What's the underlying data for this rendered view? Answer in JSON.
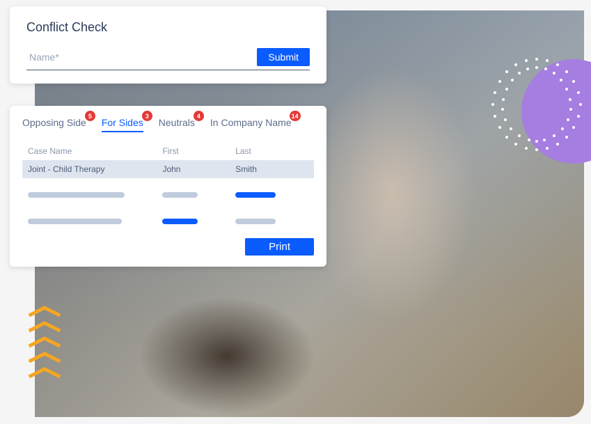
{
  "conflict_check": {
    "title": "Conflict Check",
    "name_placeholder": "Name*",
    "submit_label": "Submit"
  },
  "results": {
    "tabs": [
      {
        "label": "Opposing Side",
        "badge": "5",
        "active": false
      },
      {
        "label": "For Sides",
        "badge": "3",
        "active": true
      },
      {
        "label": "Neutrals",
        "badge": "4",
        "active": false
      },
      {
        "label": "In Company Name",
        "badge": "14",
        "active": false
      }
    ],
    "columns": {
      "case": "Case Name",
      "first": "First",
      "last": "Last"
    },
    "rows": [
      {
        "case": "Joint - Child Therapy",
        "first": "John",
        "last": "Smith"
      }
    ],
    "print_label": "Print"
  }
}
